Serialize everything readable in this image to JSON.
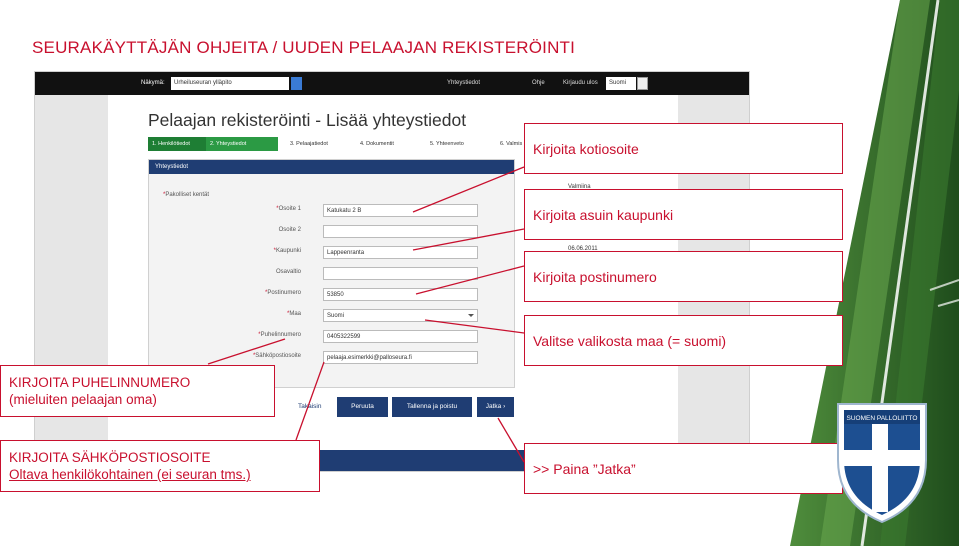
{
  "slide": {
    "title": "SEURAKÄYTTÄJÄN OHJEITA / UUDEN PELAAJAN REKISTERÖINTI"
  },
  "topbar": {
    "view_label": "Näkymä:",
    "view_value": "Urheiluseuran ylläpito",
    "items": [
      "Yhteystiedot",
      "Ohje",
      "Kirjaudu ulos"
    ],
    "language_value": "Suomi"
  },
  "page": {
    "heading": "Pelaajan rekisteröinti - Lisää yhteystiedot",
    "steps": [
      "1. Henkilötiedot",
      "2. Yhteystiedot",
      "3. Pelaajatiedot",
      "4. Dokumentit",
      "5. Yhteenveto",
      "6. Valmis"
    ],
    "section_title": "Yhteystiedot",
    "required_note": "Pakolliset kentät",
    "fields": {
      "address1": {
        "label": "Osoite 1",
        "value": "Katukatu 2 B"
      },
      "address2": {
        "label": "Osoite 2",
        "value": ""
      },
      "city": {
        "label": "Kaupunki",
        "value": "Lappeenranta"
      },
      "state": {
        "label": "Osavaltio",
        "value": ""
      },
      "postal": {
        "label": "Postinumero",
        "value": "53850"
      },
      "country": {
        "label": "Maa",
        "value": "Suomi"
      },
      "phone": {
        "label": "Puhelinnumero",
        "value": "0405322599"
      },
      "email": {
        "label": "Sähköpostiosoite",
        "value": "pelaaja.esimerkki@palloseura.fi"
      }
    },
    "side_heading": "Valmiina",
    "side_date": "06.06.2011",
    "buttons": {
      "back": "Takaisin",
      "cancel": "Peruuta",
      "save_exit": "Tallenna ja poistu",
      "continue": "Jatka"
    }
  },
  "callouts": {
    "address": "Kirjoita kotiosoite",
    "city": "Kirjoita asuin kaupunki",
    "postal": "Kirjoita postinumero",
    "country": "Valitse valikosta maa (= suomi)",
    "phone_line1": "KIRJOITA PUHELINNUMERO",
    "phone_line2": "(mieluiten pelaajan oma)",
    "email_line1": "KIRJOITA SÄHKÖPOSTIOSOITE",
    "email_line2": "Oltava henkilökohtainen (ei seuran tms.)",
    "continue": ">> Paina ”Jatka”"
  },
  "logo": {
    "text": "SUOMEN PALLOLIITTO"
  },
  "colors": {
    "accent": "#c8102e",
    "navy": "#1f3d73",
    "step_green": "#1e7e34",
    "field_green": "#2f6b2a"
  }
}
